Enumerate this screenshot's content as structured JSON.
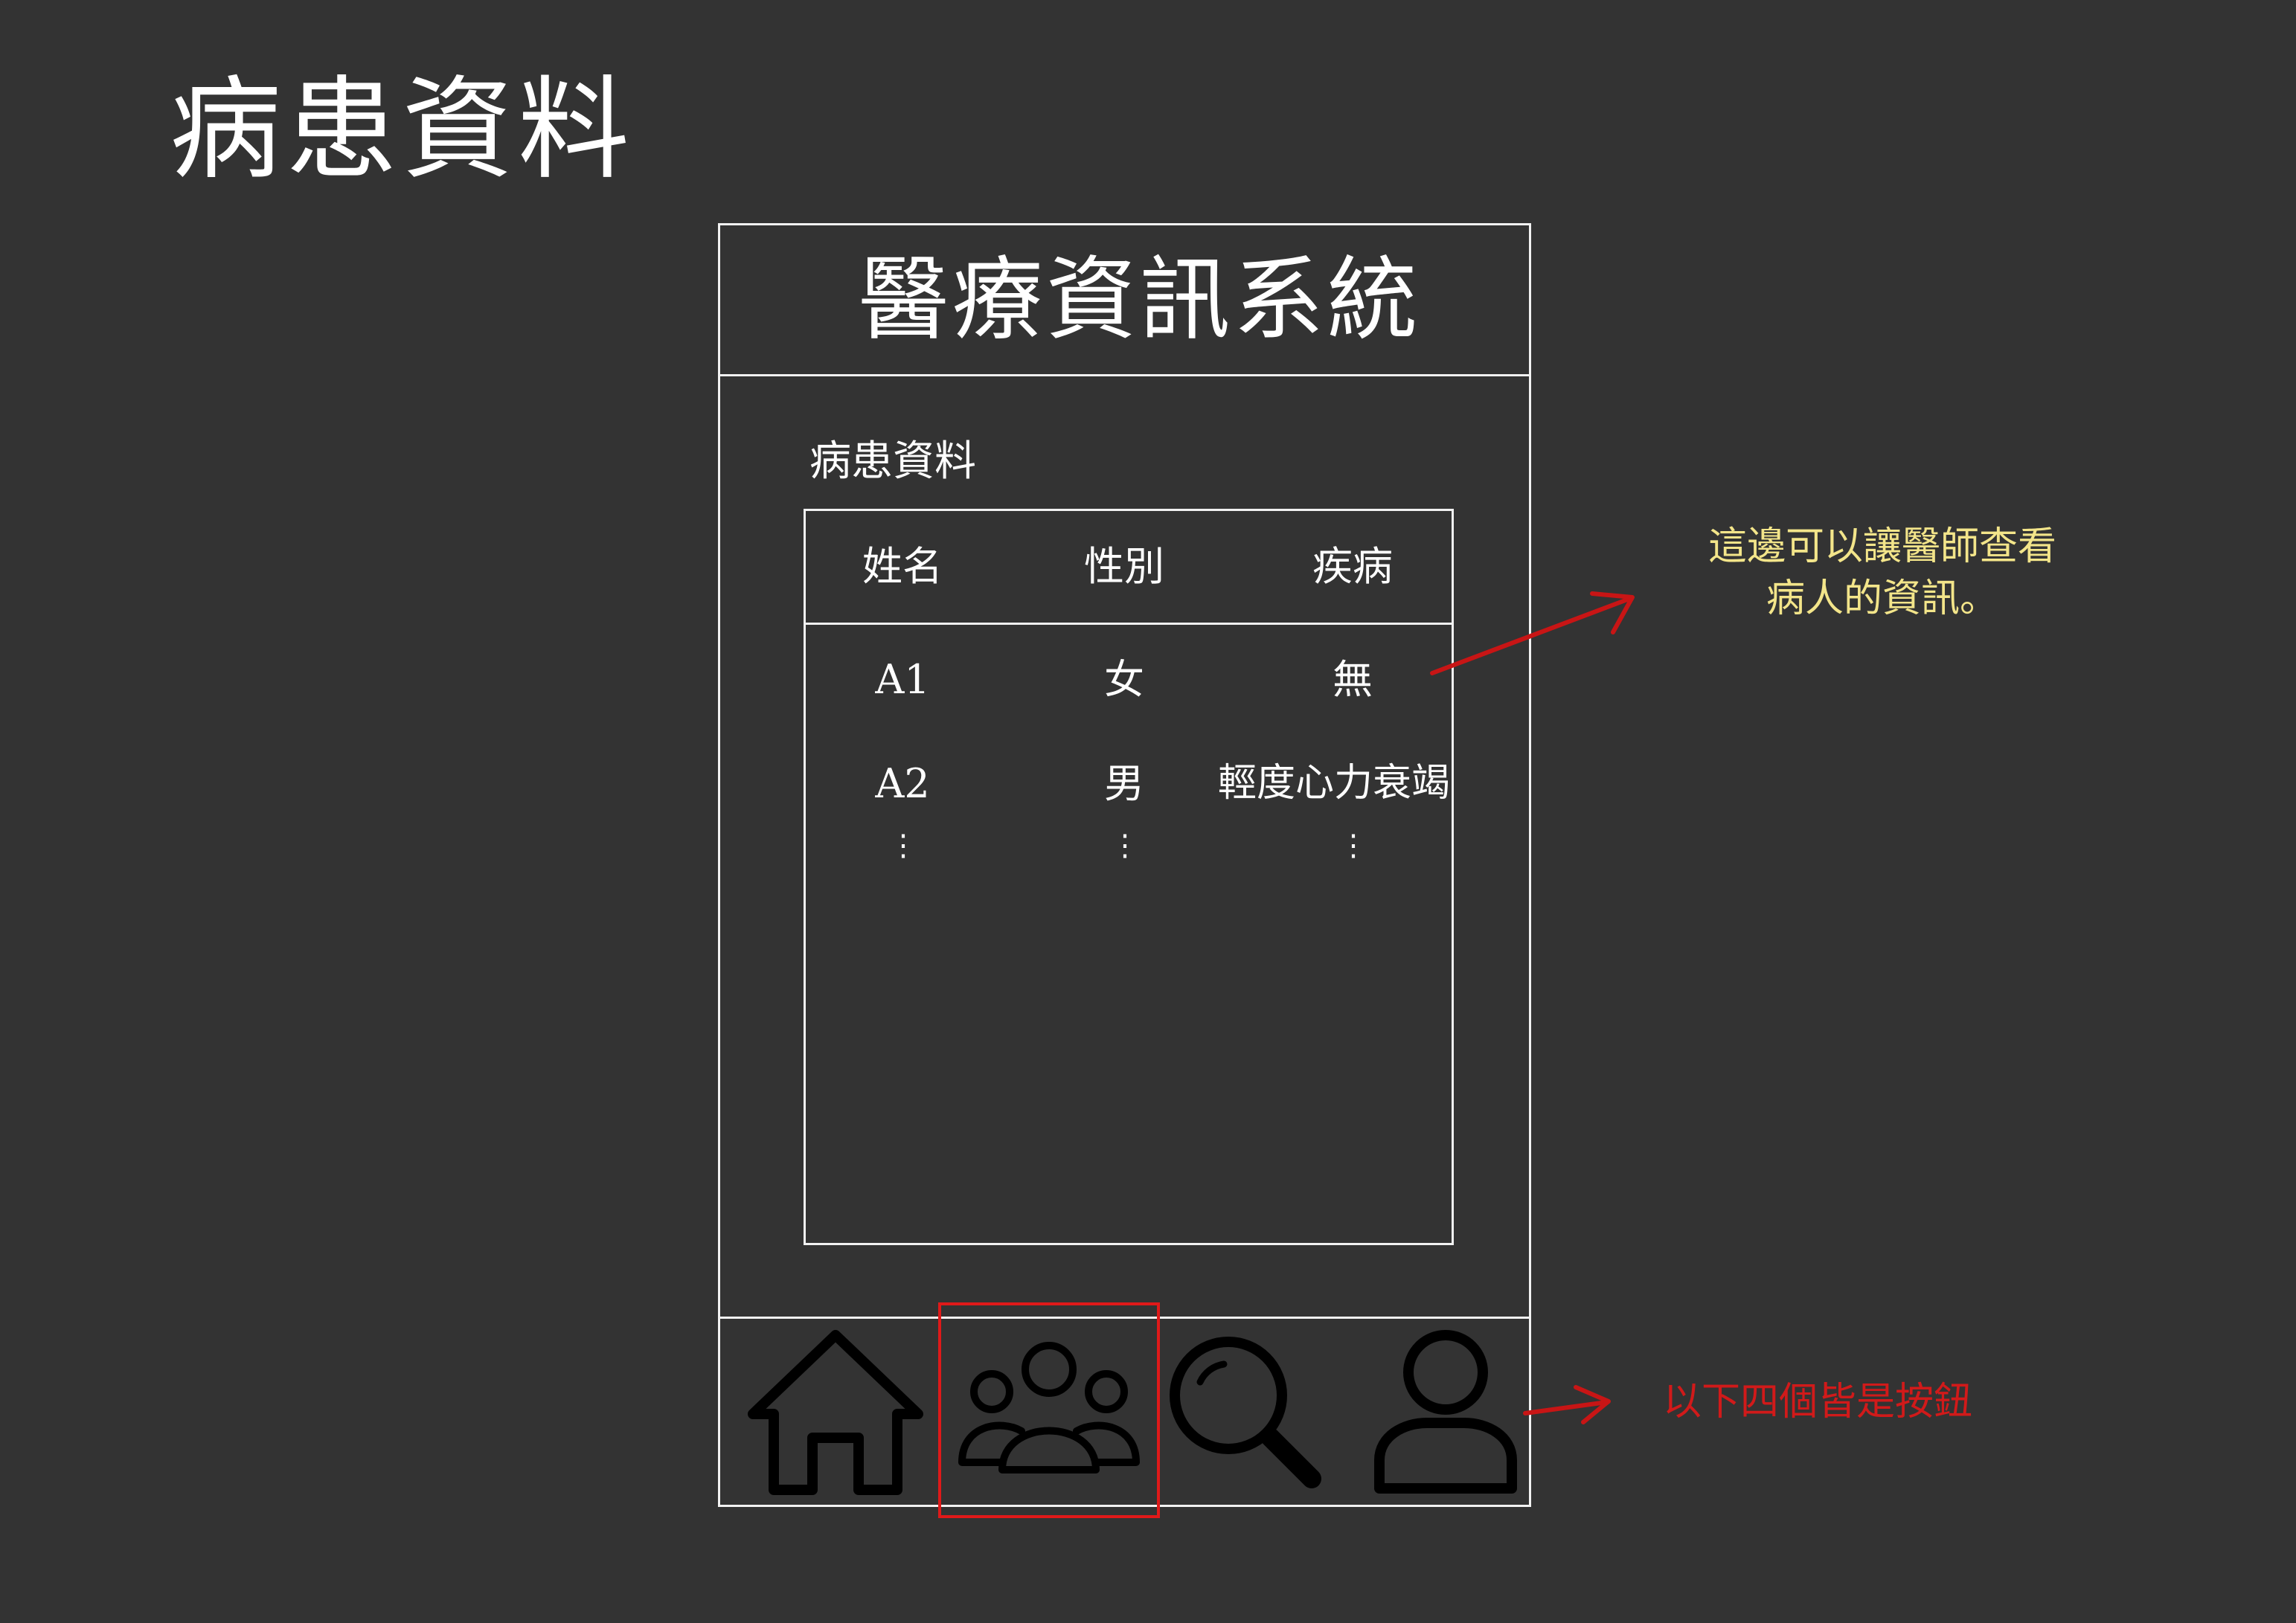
{
  "page_title": "病患資料",
  "app": {
    "title": "醫療資訊系統"
  },
  "patients_section": {
    "label": "病患資料",
    "columns": [
      "姓名",
      "性別",
      "疾病"
    ],
    "rows": [
      {
        "name": "A1",
        "gender": "女",
        "disease": "無"
      },
      {
        "name": "A2",
        "gender": "男",
        "disease": "輕度心力衰竭"
      }
    ],
    "more_indicator": "⋮"
  },
  "nav": {
    "items": [
      {
        "icon": "home-icon"
      },
      {
        "icon": "group-icon",
        "selected": true
      },
      {
        "icon": "search-icon"
      },
      {
        "icon": "user-icon"
      }
    ]
  },
  "annotations": {
    "table_note": "這邊可以讓醫師查看病人的資訊。",
    "nav_note": "以下四個皆是按鈕"
  },
  "colors": {
    "background": "#333333",
    "line": "#f2f2f2",
    "highlight": "#e01919",
    "note_yellow": "#f3e58a",
    "note_red": "#d11a1a"
  }
}
